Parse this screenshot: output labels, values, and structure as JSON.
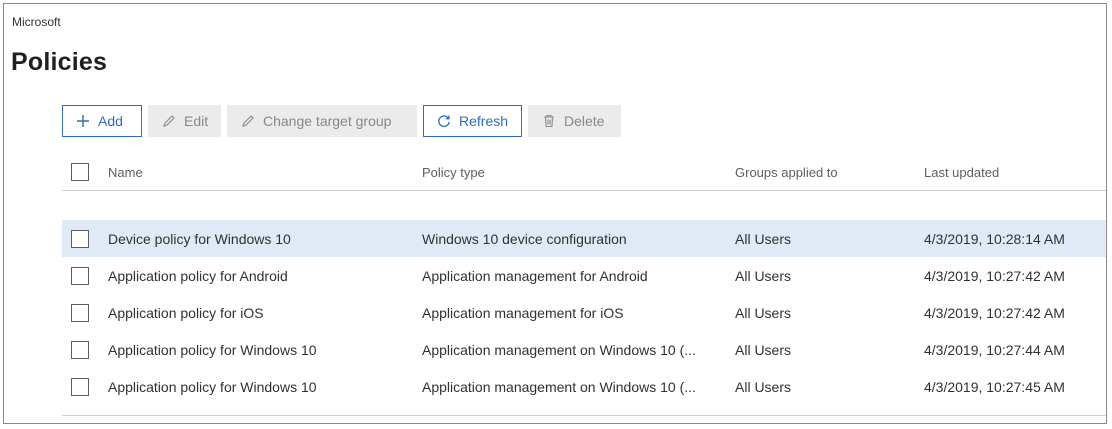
{
  "app": {
    "brand": "Microsoft",
    "page_title": "Policies"
  },
  "toolbar": {
    "buttons": [
      {
        "label": "Add",
        "icon": "plus-icon",
        "state": "enabled"
      },
      {
        "label": "Edit",
        "icon": "pencil-icon",
        "state": "disabled"
      },
      {
        "label": "Change target group",
        "icon": "pencil-icon",
        "state": "disabled"
      },
      {
        "label": "Refresh",
        "icon": "refresh-icon",
        "state": "enabled"
      },
      {
        "label": "Delete",
        "icon": "trash-icon",
        "state": "disabled"
      }
    ]
  },
  "table": {
    "columns": [
      "Name",
      "Policy type",
      "Groups applied to",
      "Last updated"
    ],
    "rows": [
      {
        "name": "Device policy for Windows 10",
        "type": "Windows 10 device configuration",
        "groups": "All Users",
        "updated": "4/3/2019, 10:28:14 AM",
        "selected": true
      },
      {
        "name": "Application policy for Android",
        "type": "Application management for Android",
        "groups": "All Users",
        "updated": "4/3/2019, 10:27:42 AM",
        "selected": false
      },
      {
        "name": "Application policy for iOS",
        "type": "Application management for iOS",
        "groups": "All Users",
        "updated": "4/3/2019, 10:27:42 AM",
        "selected": false
      },
      {
        "name": "Application policy for Windows 10",
        "type": "Application management on Windows 10 (...",
        "groups": "All Users",
        "updated": "4/3/2019, 10:27:44 AM",
        "selected": false
      },
      {
        "name": "Application policy for Windows 10",
        "type": "Application management on Windows 10 (...",
        "groups": "All Users",
        "updated": "4/3/2019, 10:27:45 AM",
        "selected": false
      }
    ]
  },
  "colors": {
    "accent": "#2b6cc4",
    "selected_row": "#dfeaf6",
    "disabled_button": "#ebebeb"
  }
}
